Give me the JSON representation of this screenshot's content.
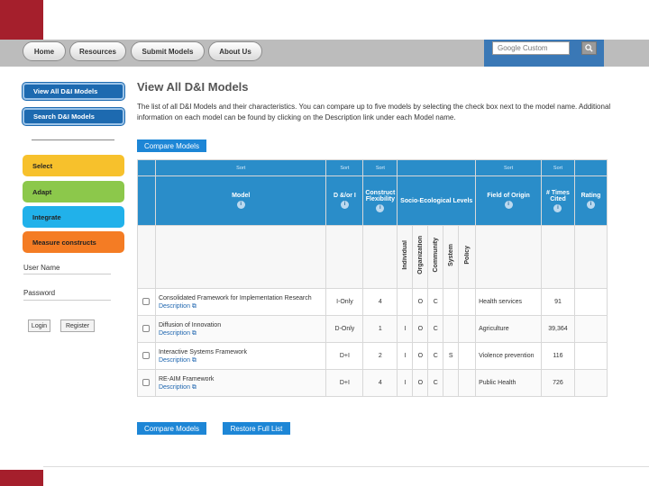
{
  "nav": {
    "home": "Home",
    "resources": "Resources",
    "submit_models": "Submit Models",
    "about_us": "About Us",
    "search_placeholder": "Google Custom",
    "search_icon": "magnifier-icon"
  },
  "sidebar": {
    "view_all": "View All D&I Models",
    "search": "Search D&I Models",
    "steps": [
      {
        "label": "Select",
        "color": "#f7c12c"
      },
      {
        "label": "Adapt",
        "color": "#8cc84b"
      },
      {
        "label": "Integrate",
        "color": "#21b1ea"
      },
      {
        "label": "Measure constructs",
        "color": "#f47c24"
      }
    ],
    "user_name_label": "User Name",
    "password_label": "Password",
    "login": "Login",
    "register": "Register"
  },
  "main": {
    "title": "View All D&I Models",
    "intro": "The list of all D&I Models and their characteristics. You can compare up to five models by selecting the check box next to the model name. Additional information on each model can be found by clicking on the Description link under each Model name.",
    "compare_top": "Compare Models",
    "compare_bottom": "Compare Models",
    "restore": "Restore Full List"
  },
  "table": {
    "sort_label": "Sort",
    "headers": {
      "model": "Model",
      "di": "D &/or I",
      "flex": "Construct Flexibility",
      "socio": "Socio-Ecological Levels",
      "field": "Field of Origin",
      "cited": "# Times Cited",
      "rating": "Rating"
    },
    "levels": [
      "Individual",
      "Organization",
      "Community",
      "System",
      "Policy"
    ],
    "description_label": "Description",
    "rows": [
      {
        "name": "Consolidated Framework for Implementation Research",
        "di": "I-Only",
        "flex": "4",
        "levels": [
          "",
          "O",
          "C",
          "",
          ""
        ],
        "field": "Health services",
        "cited": "91"
      },
      {
        "name": "Diffusion of Innovation",
        "di": "D-Only",
        "flex": "1",
        "levels": [
          "I",
          "O",
          "C",
          "",
          ""
        ],
        "field": "Agriculture",
        "cited": "39,364"
      },
      {
        "name": "Interactive Systems Framework",
        "di": "D+I",
        "flex": "2",
        "levels": [
          "I",
          "O",
          "C",
          "S",
          ""
        ],
        "field": "Violence prevention",
        "cited": "116"
      },
      {
        "name": "RE-AIM Framework",
        "di": "D+I",
        "flex": "4",
        "levels": [
          "I",
          "O",
          "C",
          "",
          ""
        ],
        "field": "Public Health",
        "cited": "726"
      }
    ]
  }
}
